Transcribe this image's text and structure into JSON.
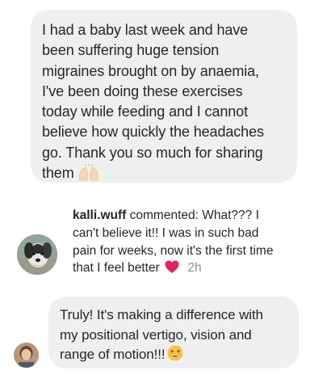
{
  "message1": {
    "lines": [
      "I had a baby last week and have",
      "been suffering huge tension",
      "migraines brought on by anaemia,",
      "I've been doing these exercises",
      "today while feeding and I cannot",
      "believe how quickly the headaches",
      "go. Thank you so much for sharing",
      "them"
    ],
    "emoji": "raising-hands-icon"
  },
  "notification": {
    "username": "kalli.wuff",
    "lines": [
      "commented: What??? I",
      "can't believe it!! I was in such bad",
      "pain for weeks, now it's the first time",
      "that I feel better"
    ],
    "emoji": "red-heart-icon",
    "time": "2h"
  },
  "message2": {
    "lines": [
      "Truly! It's making a difference with",
      "my positional vertigo, vision and",
      "range of motion!!!"
    ],
    "emoji": "star-struck-icon"
  },
  "colors": {
    "bubble": "#efefef",
    "text": "#262626",
    "muted": "#8e8e8e",
    "heart": "#e0245e"
  }
}
